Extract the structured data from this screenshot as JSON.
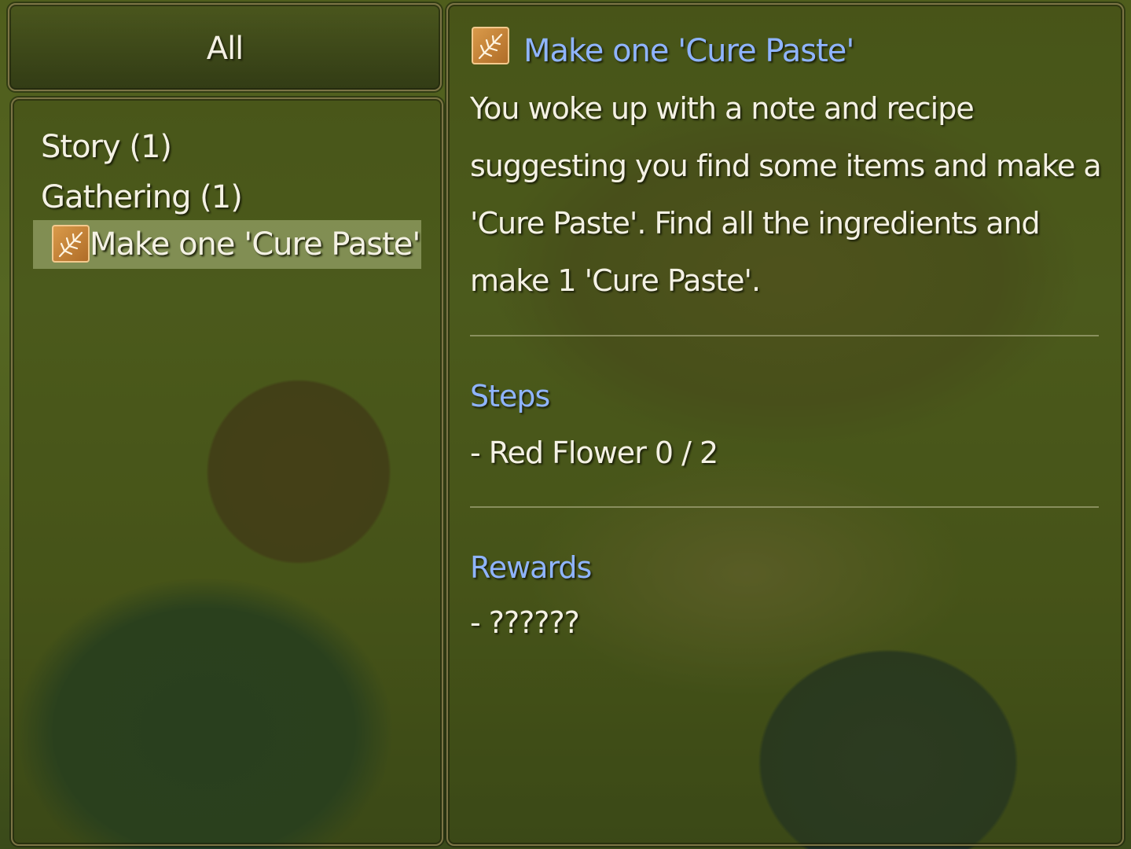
{
  "category_header": {
    "title": "All"
  },
  "quest_list": {
    "categories": [
      {
        "label": "Story (1)"
      },
      {
        "label": "Gathering (1)"
      }
    ],
    "selected_quest": {
      "label": "Make one 'Cure Paste'",
      "icon": "herb-icon"
    }
  },
  "quest_detail": {
    "icon": "herb-icon",
    "title": "Make one 'Cure Paste'",
    "description_lines": [
      "You woke up with a note and recipe",
      "suggesting you find some items and make a",
      "'Cure Paste'. Find all the ingredients and",
      "make 1 'Cure Paste'."
    ],
    "steps_heading": "Steps",
    "steps": [
      "- Red Flower 0 / 2"
    ],
    "rewards_heading": "Rewards",
    "rewards": [
      "- ??????"
    ]
  },
  "colors": {
    "heading_blue": "#8fb4ff",
    "panel_border": "#7c7446",
    "selection_highlight": "#afb982",
    "icon_orange": "#d99a4a"
  }
}
